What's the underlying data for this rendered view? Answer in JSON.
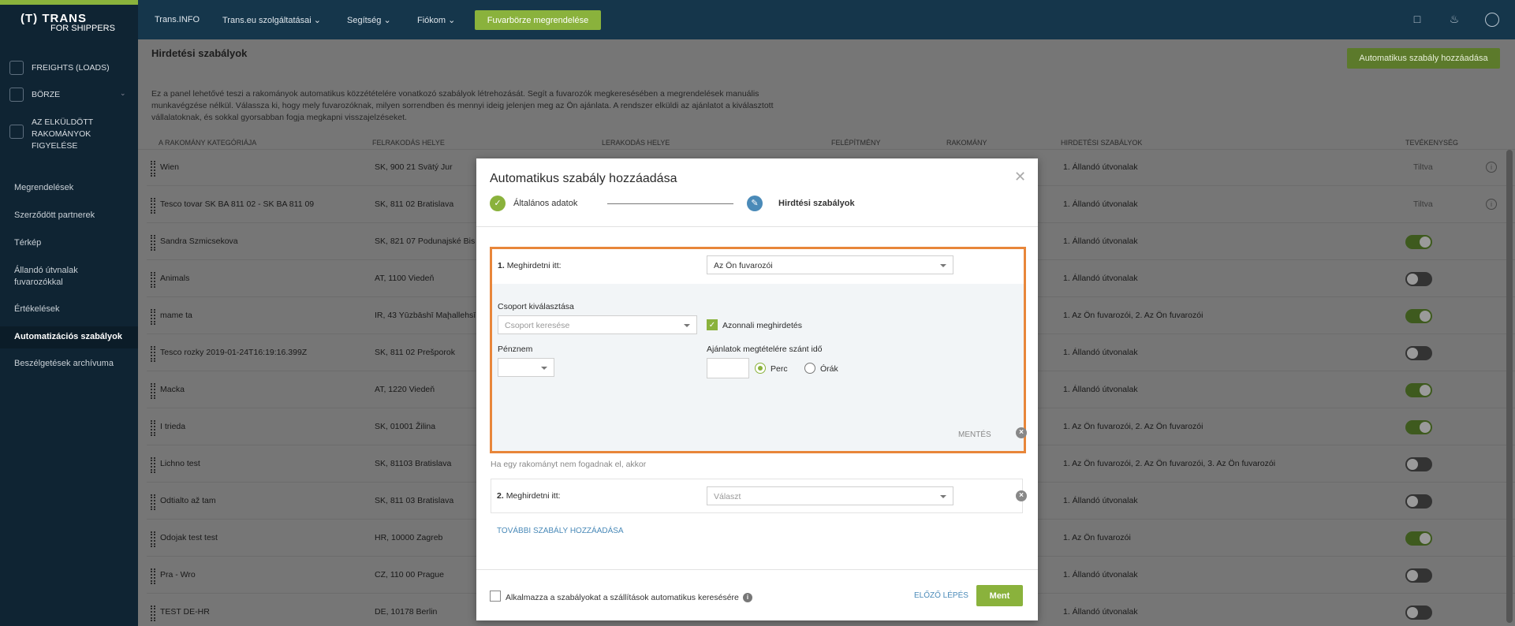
{
  "logo": {
    "line1": "(T) TRANS",
    "line2": "FOR SHIPPERS"
  },
  "sidebar": {
    "main_items": [
      {
        "label": "FREIGHTS (LOADS)",
        "icon": "freight-icon"
      },
      {
        "label": "BÖRZE",
        "icon": "cube-icon"
      },
      {
        "label": "AZ ELKÜLDÖTT RAKOMÁNYOK FIGYELÉSE",
        "icon": "tracking-icon"
      }
    ],
    "links": [
      "Megrendelések",
      "Szerződött partnerek",
      "Térkép",
      "Állandó útvnalak fuvarozókkal",
      "Értékelések",
      "Automatizációs szabályok",
      "Beszélgetések archívuma"
    ],
    "active_link": "Automatizációs szabályok"
  },
  "topbar": {
    "items": [
      "Trans.INFO",
      "Trans.eu szolgáltatásai",
      "Segítség",
      "Fiókom"
    ],
    "order_button": "Fuvarbörze megrendelése",
    "icons": [
      "chat-icon",
      "bell-icon",
      "user-icon"
    ]
  },
  "page": {
    "title": "Hirdetési szabályok",
    "add_button": "Automatikus szabály hozzáadása",
    "description": "Ez a panel lehetővé teszi a rakományok automatikus közzétételére vonatkozó szabályok létrehozását. Segít a fuvarozók megkeresésében a megrendelések manuális munkavégzése nélkül. Válassza ki, hogy mely fuvarozóknak, milyen sorrendben és mennyi ideig jelenjen meg az Ön ajánlata. A rendszer elküldi az ajánlatot a kiválasztott vállalatoknak, és sokkal gyorsabban fogja megkapni visszajelzéseket.",
    "columns": [
      "A RAKOMÁNY KATEGÓRIÁJA",
      "FELRAKODÁS HELYE",
      "LERAKODÁS HELYE",
      "FELÉPÍTMÉNY",
      "RAKOMÁNY",
      "HIRDETÉSI SZABÁLYOK",
      "TEVÉKENYSÉG"
    ],
    "rows": [
      {
        "category": "Wien",
        "loading": "SK, 900 21 Svätý Jur",
        "rules": "1. Állandó útvonalak",
        "status": "Tiltva"
      },
      {
        "category": "Tesco tovar SK BA 811 02 - SK BA 811 09",
        "loading": "SK, 811 02 Bratislava",
        "rules": "1. Állandó útvonalak",
        "status": "Tiltva"
      },
      {
        "category": "Sandra Szmicsekova",
        "loading": "SK, 821 07 Podunajské Bis",
        "rules": "1. Állandó útvonalak",
        "status": "on"
      },
      {
        "category": "Animals",
        "loading": "AT, 1100 Viedeň",
        "rules": "1. Állandó útvonalak",
        "status": "off"
      },
      {
        "category": "mame ta",
        "loading": "IR, 43 Yūzbāshī Maḩallehsī",
        "rules": "1. Az Ön fuvarozói, 2. Az Ön fuvarozói",
        "status": "on"
      },
      {
        "category": "Tesco rozky 2019-01-24T16:19:16.399Z",
        "loading": "SK, 811 02 Prešporok",
        "rules": "1. Állandó útvonalak",
        "status": "off"
      },
      {
        "category": "Macka",
        "loading": "AT, 1220 Viedeň",
        "rules": "1. Állandó útvonalak",
        "status": "on"
      },
      {
        "category": "I trieda",
        "loading": "SK, 01001 Žilina",
        "rules": "1. Az Ön fuvarozói, 2. Az Ön fuvarozói",
        "status": "on"
      },
      {
        "category": "Lichno test",
        "loading": "SK, 81103 Bratislava",
        "rules": "1. Az Ön fuvarozói, 2. Az Ön fuvarozói, 3. Az Ön fuvarozói",
        "status": "off"
      },
      {
        "category": "Odtialto až tam",
        "loading": "SK, 811 03 Bratislava",
        "rules": "1. Állandó útvonalak",
        "status": "off"
      },
      {
        "category": "Odojak test test",
        "loading": "HR, 10000 Zagreb",
        "rules": "1. Az Ön fuvarozói",
        "status": "on"
      },
      {
        "category": "Pra - Wro",
        "loading": "CZ, 110 00 Prague",
        "rules": "1. Állandó útvonalak",
        "status": "off"
      },
      {
        "category": "TEST DE-HR",
        "loading": "DE, 10178 Berlin",
        "rules": "1. Állandó útvonalak",
        "status": "off"
      }
    ]
  },
  "modal": {
    "title": "Automatikus szabály hozzáadása",
    "step1": "Általános adatok",
    "step2": "Hirdtési szabályok",
    "rule1": {
      "num": "1.",
      "label": "Meghirdetni itt:",
      "value": "Az Ön fuvarozói",
      "group_label": "Csoport kiválasztása",
      "group_placeholder": "Csoport keresése",
      "currency_label": "Pénznem",
      "currency_value": "",
      "immediate_label": "Azonnali meghirdetés",
      "immediate_checked": true,
      "time_label": "Ajánlatok megtételére szánt idő",
      "time_value": "",
      "unit_minutes": "Perc",
      "unit_hours": "Órák",
      "unit_selected": "Perc",
      "save_label": "MENTÉS"
    },
    "fallback_text": "Ha egy rakományt nem fogadnak el, akkor",
    "rule2": {
      "num": "2.",
      "label": "Meghirdetni itt:",
      "placeholder": "Választ"
    },
    "add_rule": "TOVÁBBI SZABÁLY HOZZÁADÁSA",
    "footer": {
      "apply_label": "Alkalmazza a szabályokat a szállítások automatikus keresésére",
      "prev": "ELŐZŐ LÉPÉS",
      "save": "Ment"
    }
  },
  "colors": {
    "accent": "#8ab23c",
    "link": "#4a8ab8",
    "highlight": "#e8863a",
    "nav": "#15364b"
  }
}
